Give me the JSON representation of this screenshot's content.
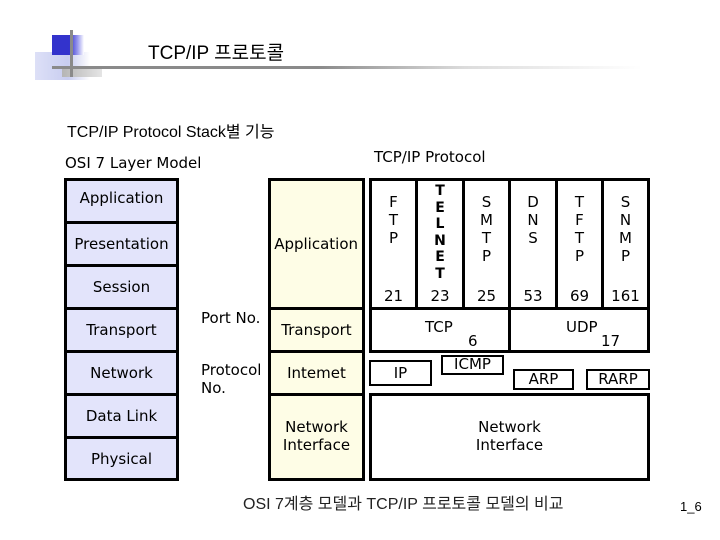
{
  "header": {
    "title": "TCP/IP 프로토콜",
    "subtitle": "TCP/IP Protocol Stack별 기능"
  },
  "osi": {
    "heading": "OSI 7 Layer Model",
    "layers": [
      "Application",
      "Presentation",
      "Session",
      "Transport",
      "Network",
      "Data Link",
      "Physical"
    ]
  },
  "side_labels": {
    "port": "Port No.",
    "protocol": "Protocol No."
  },
  "tcpip_layers": {
    "application": "Application",
    "transport": "Transport",
    "internet": "Intemet",
    "network_interface": "Network Interface"
  },
  "protocols": {
    "heading": "TCP/IP Protocol",
    "application": [
      {
        "name": "FTP",
        "letters": [
          "F",
          "T",
          "P"
        ],
        "port": "21"
      },
      {
        "name": "TELNET",
        "letters": [
          "T",
          "E",
          "L",
          "N",
          "E",
          "T"
        ],
        "port": "23"
      },
      {
        "name": "SMTP",
        "letters": [
          "S",
          "M",
          "T",
          "P"
        ],
        "port": "25"
      },
      {
        "name": "DNS",
        "letters": [
          "D",
          "N",
          "S"
        ],
        "port": "53"
      },
      {
        "name": "TFTP",
        "letters": [
          "T",
          "F",
          "T",
          "P"
        ],
        "port": "69"
      },
      {
        "name": "SNMP",
        "letters": [
          "S",
          "N",
          "M",
          "P"
        ],
        "port": "161"
      }
    ],
    "transport": [
      {
        "name": "TCP",
        "number": "6"
      },
      {
        "name": "UDP",
        "number": "17"
      }
    ],
    "internet": [
      "IP",
      "ICMP",
      "ARP",
      "RARP"
    ],
    "network_interface": "Network Interface"
  },
  "footer": {
    "caption": "OSI 7계층 모델과 TCP/IP 프로토콜 모델의 비교",
    "page": "1_6"
  },
  "colors": {
    "osi_fill": "#e3e4fb",
    "tcpip_fill": "#fefde6",
    "logo_blue": "#3333cc"
  }
}
